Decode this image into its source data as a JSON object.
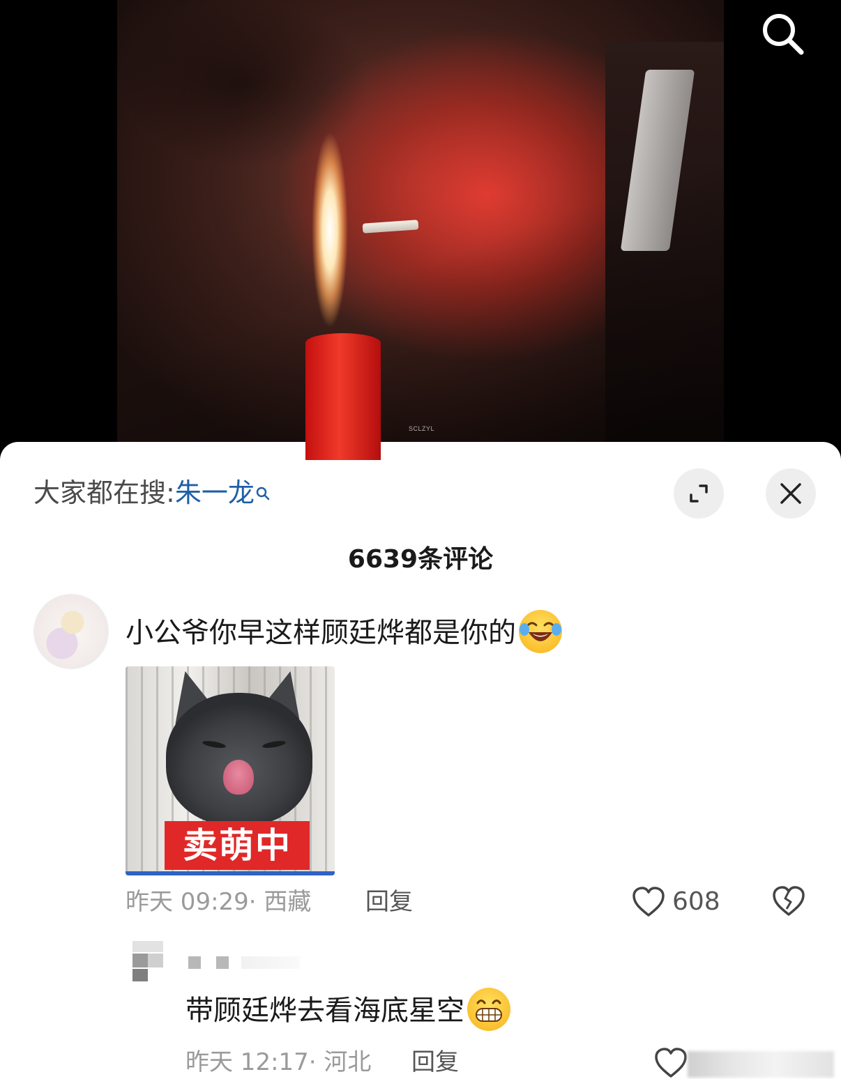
{
  "video": {
    "watermark": "SCLZYL"
  },
  "sheet": {
    "search_hint_label": "大家都在搜",
    "search_hint_sep": ":",
    "search_hint_term": "朱一龙",
    "comment_count": "6639条评论"
  },
  "comments": [
    {
      "text": "小公爷你早这样顾廷烨都是你的",
      "emoji": "tears-of-joy-emoji",
      "image_caption": "卖萌中",
      "time": "昨天 09:29",
      "location": "· 西藏",
      "reply_label": "回复",
      "likes": "608"
    }
  ],
  "replies": [
    {
      "text": "带顾廷烨去看海底星空",
      "emoji": "grinning-emoji",
      "time": "昨天 12:17",
      "location": "· 河北",
      "reply_label": "回复"
    }
  ],
  "colors": {
    "link_blue": "#1f5fa8",
    "text_dark": "#1a1a1a",
    "text_meta": "#9a9a9a",
    "button_bg": "#eeeeee"
  }
}
